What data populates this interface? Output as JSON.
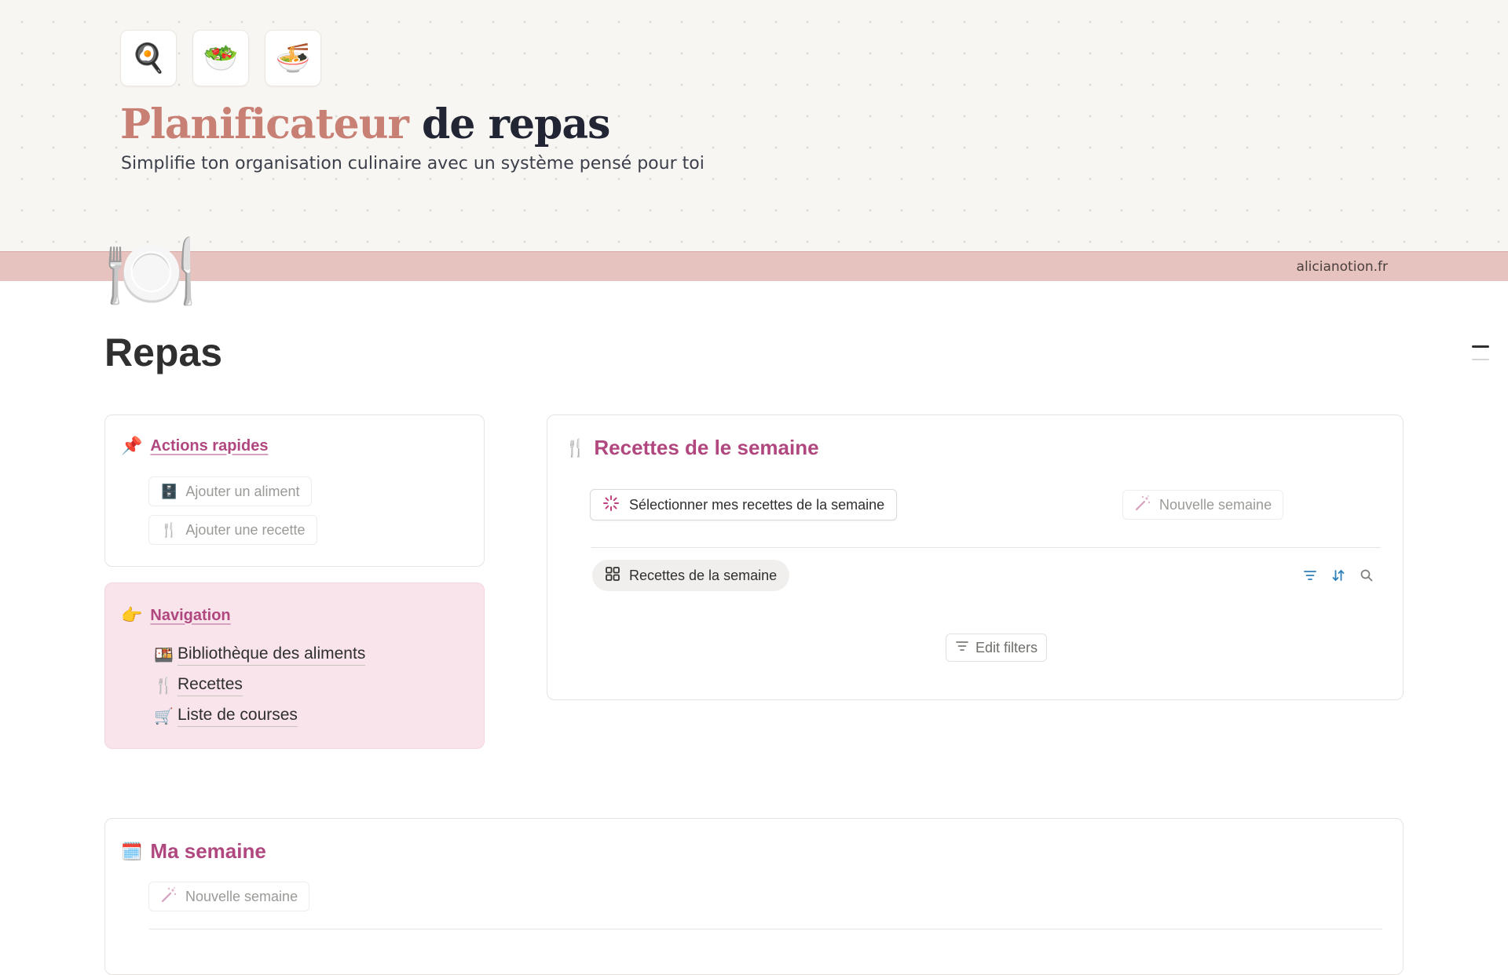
{
  "cover": {
    "icons": [
      {
        "name": "fried-egg-pan-icon",
        "glyph": "🍳"
      },
      {
        "name": "salad-bowl-icon",
        "glyph": "🥗"
      },
      {
        "name": "noodle-bowl-icon",
        "glyph": "🍜"
      }
    ],
    "title_accent": "Planificateur",
    "title_rest": "de repas",
    "subtitle": "Simplifie ton organisation culinaire avec un système pensé pour toi",
    "site_credit": "alicianotion.fr",
    "accent_color": "#c87f74",
    "band_color": "#e6c3bf"
  },
  "page": {
    "icon": "🍽️",
    "title": "Repas"
  },
  "quick_actions": {
    "icon": "📌",
    "heading": "Actions rapides",
    "buttons": [
      {
        "icon": "🗄️",
        "label": "Ajouter un aliment"
      },
      {
        "icon": "🍴",
        "label": "Ajouter une recette"
      }
    ]
  },
  "navigation": {
    "icon": "👉",
    "heading": "Navigation",
    "items": [
      {
        "icon": "🍱",
        "label": "Bibliothèque des aliments"
      },
      {
        "icon": "🍴",
        "label": "Recettes"
      },
      {
        "icon": "🛒",
        "label": "Liste de courses"
      }
    ],
    "background": "#f9e4ec"
  },
  "weekly_recipes": {
    "icon": "🍴",
    "heading": "Recettes de le semaine",
    "select_button": "Sélectionner mes recettes de la semaine",
    "new_week_button": "Nouvelle semaine",
    "view_tab": "Recettes de la semaine",
    "edit_filters": "Edit filters",
    "tool_icons": [
      "filter-icon",
      "sort-icon",
      "search-icon"
    ]
  },
  "my_week": {
    "icon": "🗓️",
    "heading": "Ma semaine",
    "new_week_button": "Nouvelle semaine"
  },
  "colors": {
    "heading_pink": "#b0487f",
    "toolbar_blue": "#2e7fb8"
  }
}
